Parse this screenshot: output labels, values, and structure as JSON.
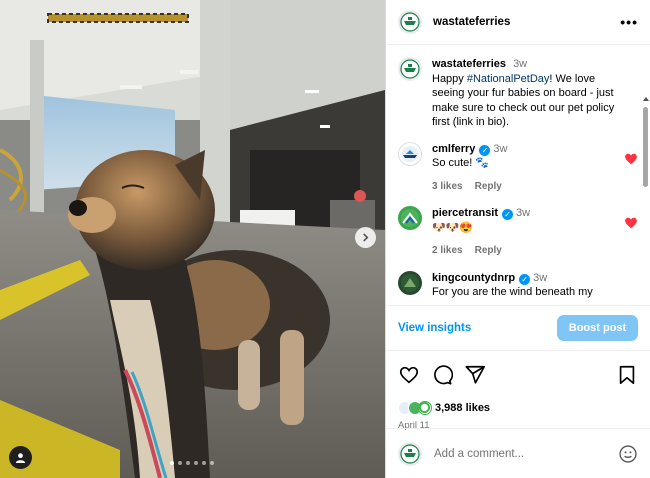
{
  "post": {
    "author": "wastateferries",
    "image_alt": "Dog on a ferry car deck",
    "carousel_dots": 6,
    "active_dot": 0
  },
  "caption": {
    "user": "wastateferries",
    "time": "3w",
    "text_before": "Happy ",
    "hashtag": "#NationalPetDay",
    "text_after": "! We love seeing your fur babies on board - just make sure to check out our pet policy first (link in bio)."
  },
  "comments": [
    {
      "user": "cmlferry",
      "verified": true,
      "time": "3w",
      "text": "So cute! 🐾",
      "likes": "3 likes",
      "reply": "Reply",
      "liked": true
    },
    {
      "user": "piercetransit",
      "verified": true,
      "time": "3w",
      "text": "🐶🐶😍",
      "likes": "2 likes",
      "reply": "Reply",
      "liked": true
    },
    {
      "user": "kingcountydnrp",
      "verified": true,
      "time": "3w",
      "text": "For you are the wind beneath my"
    }
  ],
  "actions": {
    "insights": "View insights",
    "boost": "Boost post"
  },
  "engagement": {
    "likes": "3,988 likes",
    "date": "April 11"
  },
  "composer": {
    "placeholder": "Add a comment..."
  },
  "colors": {
    "link_blue": "#0095f6",
    "boost_blue": "#7fc6f7",
    "heart_red": "#ff3040",
    "ferry_green": "#1a7f4b"
  },
  "icons": {
    "more": "•••",
    "heart": "heart-icon",
    "comment": "comment-icon",
    "share": "share-icon",
    "save": "bookmark-icon",
    "emoji": "emoji-icon"
  }
}
